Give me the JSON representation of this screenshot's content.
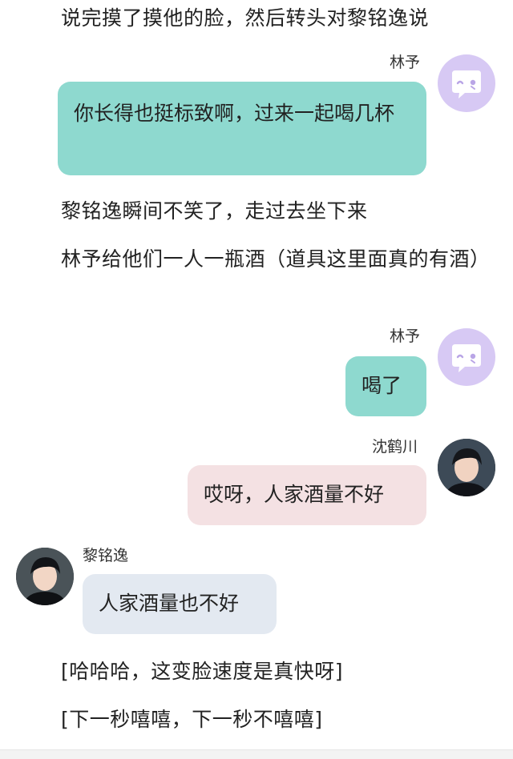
{
  "narration": [
    "说完摸了摸他的脸，然后转头对黎铭逸说",
    "黎铭逸瞬间不笑了，走过去坐下来",
    "林予给他们一人一瓶酒（道具这里面真的有酒）",
    "[哈哈哈，这变脸速度是真快呀]",
    "[下一秒嘻嘻，下一秒不嘻嘻]"
  ],
  "messages": [
    {
      "sender": "林予",
      "text": "你长得也挺标致啊，过来一起喝几杯",
      "side": "right",
      "color": "#8ed9cf",
      "avatar": "bot-face-icon"
    },
    {
      "sender": "林予",
      "text": "喝了",
      "side": "right",
      "color": "#8ed9cf",
      "avatar": "bot-face-icon"
    },
    {
      "sender": "沈鹤川",
      "text": "哎呀，人家酒量不好",
      "side": "right",
      "color": "#f4e1e3",
      "avatar": "user-photo"
    },
    {
      "sender": "黎铭逸",
      "text": "人家酒量也不好",
      "side": "left",
      "color": "#e3e9f1",
      "avatar": "user-photo"
    }
  ]
}
